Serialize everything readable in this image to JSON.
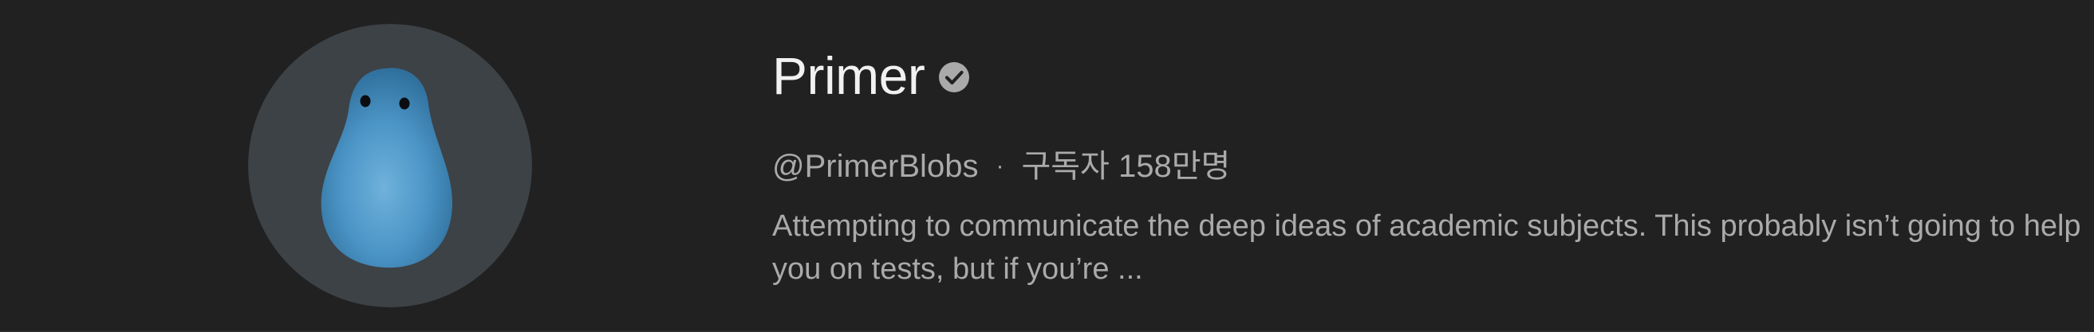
{
  "channel": {
    "name": "Primer",
    "verified_icon": "verified-check-icon",
    "handle": "@PrimerBlobs",
    "separator": "·",
    "subscribers": "구독자 158만명",
    "description": "Attempting to communicate the deep ideas of academic subjects. This probably isn’t going to help you on tests, but if you’re ...",
    "avatar_icon": "blue-blob-avatar"
  },
  "colors": {
    "background": "#212121",
    "title": "#f1f1f1",
    "secondary_text": "#aaaaaa",
    "avatar_bg": "#3d4246",
    "blob": "#4a93c4"
  }
}
